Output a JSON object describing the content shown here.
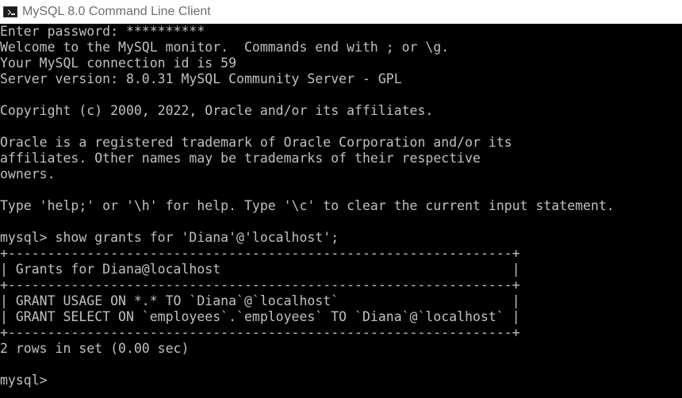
{
  "window": {
    "title": "MySQL 8.0 Command Line Client",
    "icon": "terminal-icon"
  },
  "console": {
    "lines": [
      "Enter password: **********",
      "Welcome to the MySQL monitor.  Commands end with ; or \\g.",
      "Your MySQL connection id is 59",
      "Server version: 8.0.31 MySQL Community Server - GPL",
      "",
      "Copyright (c) 2000, 2022, Oracle and/or its affiliates.",
      "",
      "Oracle is a registered trademark of Oracle Corporation and/or its",
      "affiliates. Other names may be trademarks of their respective",
      "owners.",
      "",
      "Type 'help;' or '\\h' for help. Type '\\c' to clear the current input statement.",
      "",
      "mysql> show grants for 'Diana'@'localhost';",
      "+----------------------------------------------------------------+",
      "| Grants for Diana@localhost                                     |",
      "+----------------------------------------------------------------+",
      "| GRANT USAGE ON *.* TO `Diana`@`localhost`                      |",
      "| GRANT SELECT ON `employees`.`employees` TO `Diana`@`localhost` |",
      "+----------------------------------------------------------------+",
      "2 rows in set (0.00 sec)",
      "",
      "mysql>"
    ]
  },
  "colors": {
    "text": "#c0c0c0",
    "background": "#000000",
    "titlebar": "#ffffff",
    "title_text": "#6e6e6e"
  }
}
